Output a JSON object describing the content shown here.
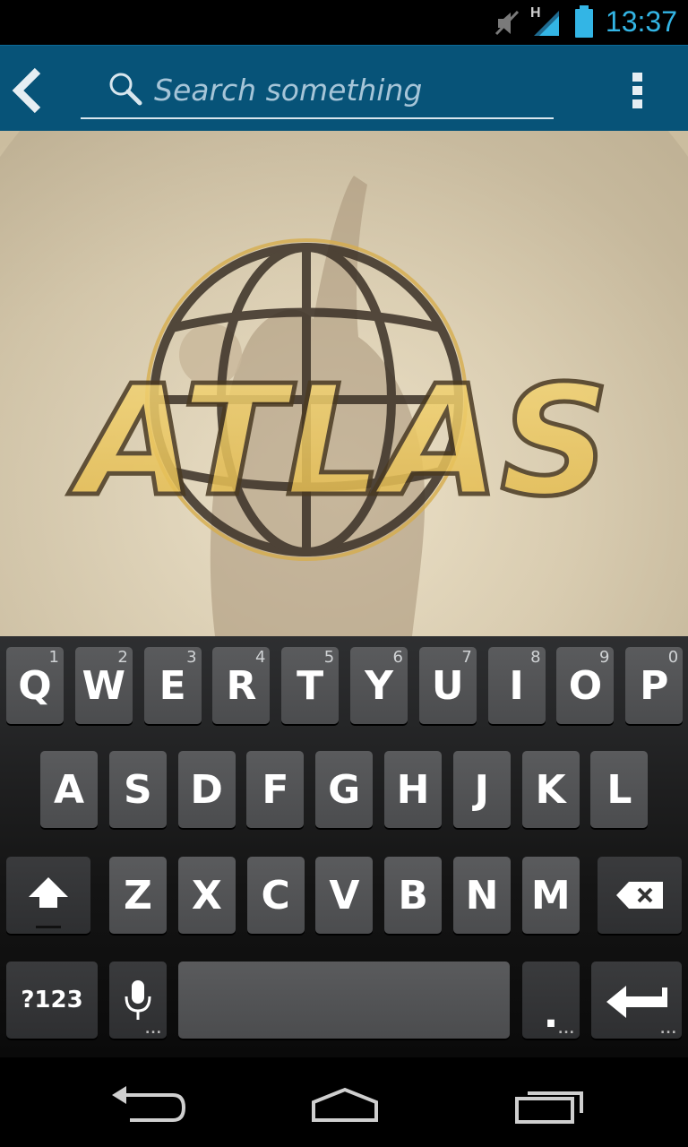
{
  "status_bar": {
    "time": "13:37",
    "network_label": "H",
    "icons": [
      "muted-icon",
      "signal-icon",
      "battery-icon"
    ],
    "accent_color": "#33b5e5"
  },
  "action_bar": {
    "search_placeholder": "Search something",
    "icons": [
      "back-icon",
      "search-icon",
      "overflow-menu-icon"
    ],
    "bar_color": "#075378"
  },
  "hero": {
    "logo_text": "ATLAS"
  },
  "keyboard": {
    "row1": [
      {
        "label": "Q",
        "hint": "1"
      },
      {
        "label": "W",
        "hint": "2"
      },
      {
        "label": "E",
        "hint": "3"
      },
      {
        "label": "R",
        "hint": "4"
      },
      {
        "label": "T",
        "hint": "5"
      },
      {
        "label": "Y",
        "hint": "6"
      },
      {
        "label": "U",
        "hint": "7"
      },
      {
        "label": "I",
        "hint": "8"
      },
      {
        "label": "O",
        "hint": "9"
      },
      {
        "label": "P",
        "hint": "0"
      }
    ],
    "row2": [
      "A",
      "S",
      "D",
      "F",
      "G",
      "H",
      "J",
      "K",
      "L"
    ],
    "row3": [
      "Z",
      "X",
      "C",
      "V",
      "B",
      "N",
      "M"
    ],
    "symbols_label": "?123",
    "period_label": ".",
    "special_icons": [
      "shift-icon",
      "backspace-icon",
      "microphone-icon",
      "enter-icon"
    ]
  },
  "nav_bar": {
    "icons": [
      "nav-back-icon",
      "home-icon",
      "recent-apps-icon"
    ]
  }
}
